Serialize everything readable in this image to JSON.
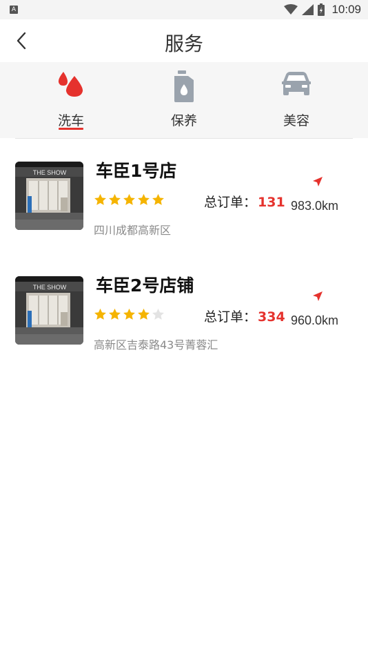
{
  "status_bar": {
    "time": "10:09",
    "left_icon": "A"
  },
  "header": {
    "title": "服务"
  },
  "tabs": [
    {
      "label": "洗车",
      "icon": "water-drop-icon",
      "active": true,
      "color": "#e5322d"
    },
    {
      "label": "保养",
      "icon": "oil-can-icon",
      "active": false,
      "color": "#9aa3ad"
    },
    {
      "label": "美容",
      "icon": "car-icon",
      "active": false,
      "color": "#9aa3ad"
    }
  ],
  "stores": [
    {
      "name": "车臣1号店",
      "rating": 5,
      "max_rating": 5,
      "orders_label": "总订单：",
      "orders_count": "131",
      "distance": "983.0km",
      "address": "四川成都高新区",
      "sign_text": "THE SHOW"
    },
    {
      "name": "车臣2号店铺",
      "rating": 4,
      "max_rating": 5,
      "orders_label": "总订单：",
      "orders_count": "334",
      "distance": "960.0km",
      "address": "高新区吉泰路43号菁蓉汇",
      "sign_text": "THE SHOW"
    }
  ],
  "colors": {
    "accent": "#e5322d",
    "star": "#f5b400",
    "star_empty": "#e3e3e3",
    "inactive_icon": "#9aa3ad"
  }
}
